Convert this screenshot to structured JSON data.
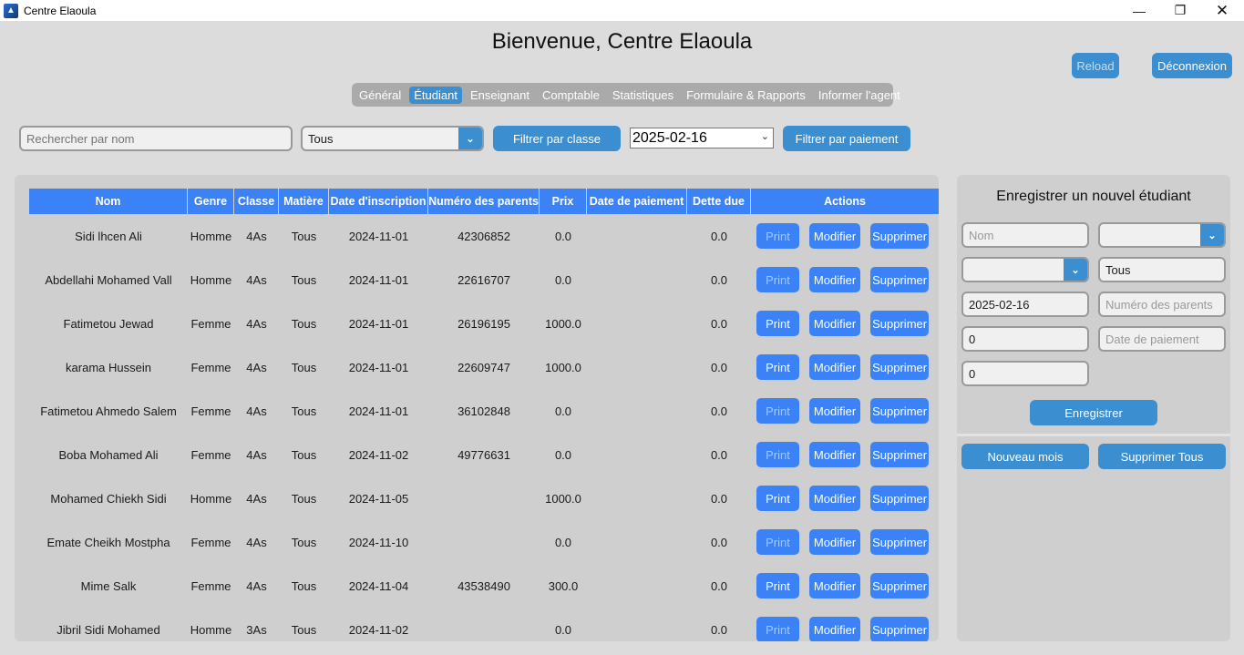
{
  "window": {
    "title": "Centre Elaoula",
    "icon": "app-icon"
  },
  "header": {
    "title": "Bienvenue, Centre Elaoula",
    "reload_label": "Reload",
    "logout_label": "Déconnexion"
  },
  "tabs": [
    {
      "label": "Général",
      "active": false
    },
    {
      "label": "Étudiant",
      "active": true
    },
    {
      "label": "Enseignant",
      "active": false
    },
    {
      "label": "Comptable",
      "active": false
    },
    {
      "label": "Statistiques",
      "active": false
    },
    {
      "label": "Formulaire & Rapports",
      "active": false
    },
    {
      "label": "Informer l'agent",
      "active": false
    }
  ],
  "filters": {
    "search_placeholder": "Rechercher par nom",
    "class_value": "Tous",
    "class_button": "Filtrer par classe",
    "date_value": "2025-02-16",
    "payment_button": "Filtrer par paiement"
  },
  "table": {
    "columns": [
      "Nom",
      "Genre",
      "Classe",
      "Matière",
      "Date d'inscription",
      "Numéro des parents",
      "Prix",
      "Date de paiement",
      "Dette due",
      "Actions"
    ],
    "action_labels": {
      "print": "Print",
      "edit": "Modifier",
      "delete": "Supprimer"
    },
    "rows": [
      {
        "nom": "Sidi lhcen Ali",
        "genre": "Homme",
        "classe": "4As",
        "matiere": "Tous",
        "date": "2024-11-01",
        "parents": "42306852",
        "prix": "0.0",
        "paiement": "",
        "dette": "0.0"
      },
      {
        "nom": "Abdellahi Mohamed Vall",
        "genre": "Homme",
        "classe": "4As",
        "matiere": "Tous",
        "date": "2024-11-01",
        "parents": "22616707",
        "prix": "0.0",
        "paiement": "",
        "dette": "0.0"
      },
      {
        "nom": "Fatimetou Jewad",
        "genre": "Femme",
        "classe": "4As",
        "matiere": "Tous",
        "date": "2024-11-01",
        "parents": "26196195",
        "prix": "1000.0",
        "paiement": "",
        "dette": "0.0"
      },
      {
        "nom": "karama Hussein",
        "genre": "Femme",
        "classe": "4As",
        "matiere": "Tous",
        "date": "2024-11-01",
        "parents": "22609747",
        "prix": "1000.0",
        "paiement": "",
        "dette": "0.0"
      },
      {
        "nom": "Fatimetou Ahmedo Salem",
        "genre": "Femme",
        "classe": "4As",
        "matiere": "Tous",
        "date": "2024-11-01",
        "parents": "36102848",
        "prix": "0.0",
        "paiement": "",
        "dette": "0.0"
      },
      {
        "nom": "Boba Mohamed Ali",
        "genre": "Femme",
        "classe": "4As",
        "matiere": "Tous",
        "date": "2024-11-02",
        "parents": "49776631",
        "prix": "0.0",
        "paiement": "",
        "dette": "0.0"
      },
      {
        "nom": "Mohamed Chiekh Sidi",
        "genre": "Homme",
        "classe": "4As",
        "matiere": "Tous",
        "date": "2024-11-05",
        "parents": "",
        "prix": "1000.0",
        "paiement": "",
        "dette": "0.0"
      },
      {
        "nom": "Emate Cheikh Mostpha",
        "genre": "Femme",
        "classe": "4As",
        "matiere": "Tous",
        "date": "2024-11-10",
        "parents": "",
        "prix": "0.0",
        "paiement": "",
        "dette": "0.0"
      },
      {
        "nom": "Mime Salk",
        "genre": "Femme",
        "classe": "4As",
        "matiere": "Tous",
        "date": "2024-11-04",
        "parents": "43538490",
        "prix": "300.0",
        "paiement": "",
        "dette": "0.0"
      },
      {
        "nom": "Jibril Sidi Mohamed",
        "genre": "Homme",
        "classe": "3As",
        "matiere": "Tous",
        "date": "2024-11-02",
        "parents": "",
        "prix": "0.0",
        "paiement": "",
        "dette": "0.0"
      }
    ]
  },
  "register": {
    "title": "Enregistrer un nouvel étudiant",
    "nom_placeholder": "Nom",
    "genre_value": "",
    "classe_value": "",
    "matiere_value": "Tous",
    "date_value": "2025-02-16",
    "parents_placeholder": "Numéro des parents",
    "prix_value": "0",
    "paiement_placeholder": "Date de paiement",
    "dette_value": "0",
    "save_label": "Enregistrer",
    "new_month_label": "Nouveau mois",
    "delete_all_label": "Supprimer Tous"
  },
  "colors": {
    "accent": "#3b82f6",
    "button": "#3b8ed0",
    "background": "#dcdcdc",
    "panel": "#cfcfcf"
  }
}
